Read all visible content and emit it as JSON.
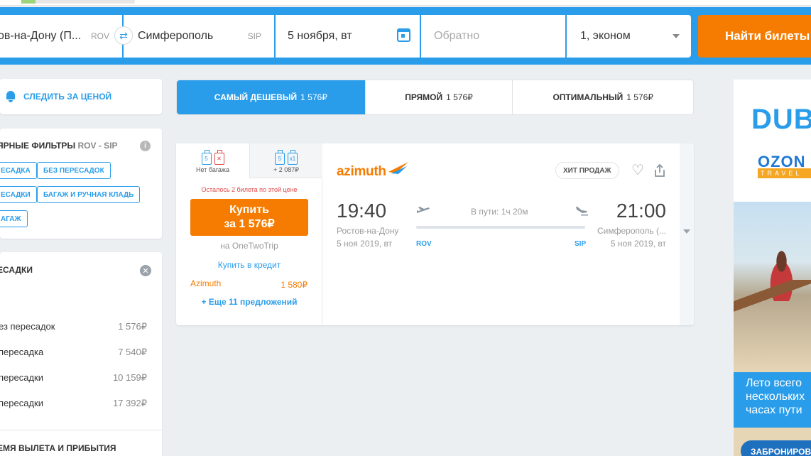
{
  "search": {
    "from": "ов-на-Дону (П...",
    "from_code": "ROV",
    "to": "Симферополь",
    "to_code": "SIP",
    "date": "5 ноября, вт",
    "return_placeholder": "Обратно",
    "passengers": "1, эконом",
    "find_label": "Найти билеты"
  },
  "sidebar": {
    "watch_price": "СЛЕДИТЬ ЗА ЦЕНОЙ",
    "filters_title": "ЯРНЫЕ ФИЛЬТРЫ",
    "filters_route": "ROV - SIP",
    "chips": [
      "ЕСАДКА",
      "БЕЗ ПЕРЕСАДОК",
      "ЕСАДКИ",
      "БАГАЖ И РУЧНАЯ КЛАДЬ",
      "АГАЖ"
    ],
    "stops_title": "ЕСАДКИ",
    "stops": [
      {
        "label": "ез пересадок",
        "price": "1 576₽"
      },
      {
        "label": "пересадка",
        "price": "7 540₽"
      },
      {
        "label": "пересадки",
        "price": "10 159₽"
      },
      {
        "label": "пересадки",
        "price": "17 392₽"
      }
    ],
    "times_title": "ЕМЯ ВЫЛЕТА И ПРИБЫТИЯ"
  },
  "sort_tabs": [
    {
      "label": "САМЫЙ ДЕШЕВЫЙ",
      "price": "1 576₽"
    },
    {
      "label": "ПРЯМОЙ",
      "price": "1 576₽"
    },
    {
      "label": "ОПТИМАЛЬНЫЙ",
      "price": "1 576₽"
    }
  ],
  "ticket": {
    "bag_options": [
      {
        "label": "Нет багажа",
        "hand": "5",
        "bag": "✕"
      },
      {
        "label": "+ 2 087₽",
        "hand": "5",
        "bag": "x1"
      }
    ],
    "seats_left": "Осталось 2 билета по этой цене",
    "buy_line1": "Купить",
    "buy_line2": "за 1 576₽",
    "via": "на OneTwoTrip",
    "credit": "Купить в кредит",
    "agent": "Azimuth",
    "agent_price": "1 580₽",
    "more_offers": "+ Еще 11 предложений",
    "airline": "azimuth",
    "badge": "ХИТ ПРОДАЖ",
    "dep_time": "19:40",
    "arr_time": "21:00",
    "dep_city": "Ростов-на-Дону",
    "arr_city": "Симферополь (...",
    "dep_date": "5 ноя 2019, вт",
    "arr_date": "5 ноя 2019, вт",
    "duration": "В пути: 1ч 20м",
    "dep_code": "ROV",
    "arr_code": "SIP"
  },
  "ad": {
    "brand1": "DUBAI",
    "brand2": "OZON",
    "brand2_sub": "TRAVEL",
    "slogan": [
      "Лето всего",
      "нескольких",
      "часах пути"
    ],
    "cta": "ЗАБРОНИРОВАТЬ"
  },
  "colors": {
    "accent": "#2a9dea",
    "cta": "#f57c00",
    "warning": "#e04848"
  }
}
